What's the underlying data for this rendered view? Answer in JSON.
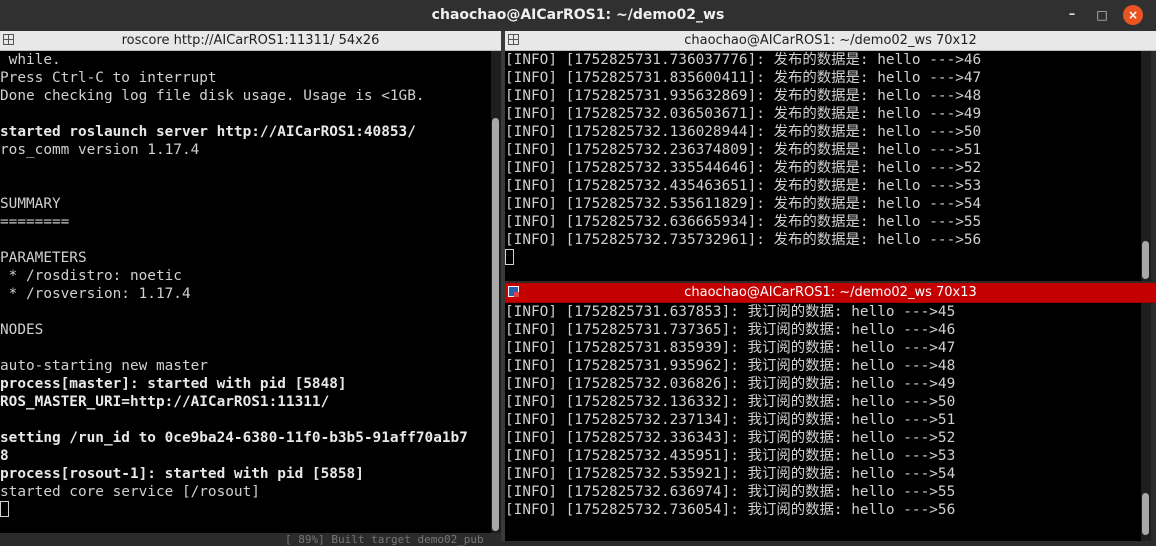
{
  "window": {
    "title": "chaochao@AICarROS1: ~/demo02_ws",
    "buttons": {
      "minimize": "–",
      "maximize": "□",
      "close": "×"
    }
  },
  "left_pane": {
    "header": "roscore http://AICarROS1:11311/ 54x26",
    "lines": [
      {
        "text": " while.",
        "bold": false
      },
      {
        "text": "Press Ctrl-C to interrupt",
        "bold": false
      },
      {
        "text": "Done checking log file disk usage. Usage is <1GB.",
        "bold": false
      },
      {
        "text": "",
        "bold": false
      },
      {
        "text": "started roslaunch server http://AICarROS1:40853/",
        "bold": true
      },
      {
        "text": "ros_comm version 1.17.4",
        "bold": false
      },
      {
        "text": "",
        "bold": false
      },
      {
        "text": "",
        "bold": false
      },
      {
        "text": "SUMMARY",
        "bold": false
      },
      {
        "text": "========",
        "bold": false
      },
      {
        "text": "",
        "bold": false
      },
      {
        "text": "PARAMETERS",
        "bold": false
      },
      {
        "text": " * /rosdistro: noetic",
        "bold": false
      },
      {
        "text": " * /rosversion: 1.17.4",
        "bold": false
      },
      {
        "text": "",
        "bold": false
      },
      {
        "text": "NODES",
        "bold": false
      },
      {
        "text": "",
        "bold": false
      },
      {
        "text": "auto-starting new master",
        "bold": false
      },
      {
        "text": "process[master]: started with pid [5848]",
        "bold": true
      },
      {
        "text": "ROS_MASTER_URI=http://AICarROS1:11311/",
        "bold": true
      },
      {
        "text": "",
        "bold": false
      },
      {
        "text": "setting /run_id to 0ce9ba24-6380-11f0-b3b5-91aff70a1b7",
        "bold": true
      },
      {
        "text": "8",
        "bold": true
      },
      {
        "text": "process[rosout-1]: started with pid [5858]",
        "bold": true
      },
      {
        "text": "started core service [/rosout]",
        "bold": false
      }
    ],
    "bottom_overflow_text": "[ 89%] Built target demo02_pub"
  },
  "top_right_pane": {
    "header": "chaochao@AICarROS1: ~/demo02_ws 70x12",
    "lines": [
      "[INFO] [1752825731.736037776]: 发布的数据是: hello --->46",
      "[INFO] [1752825731.835600411]: 发布的数据是: hello --->47",
      "[INFO] [1752825731.935632869]: 发布的数据是: hello --->48",
      "[INFO] [1752825732.036503671]: 发布的数据是: hello --->49",
      "[INFO] [1752825732.136028944]: 发布的数据是: hello --->50",
      "[INFO] [1752825732.236374809]: 发布的数据是: hello --->51",
      "[INFO] [1752825732.335544646]: 发布的数据是: hello --->52",
      "[INFO] [1752825732.435463651]: 发布的数据是: hello --->53",
      "[INFO] [1752825732.535611829]: 发布的数据是: hello --->54",
      "[INFO] [1752825732.636665934]: 发布的数据是: hello --->55",
      "[INFO] [1752825732.735732961]: 发布的数据是: hello --->56"
    ]
  },
  "bottom_right_pane": {
    "header": "chaochao@AICarROS1: ~/demo02_ws 70x13",
    "lines": [
      "[INFO] [1752825731.637853]: 我订阅的数据: hello --->45",
      "[INFO] [1752825731.737365]: 我订阅的数据: hello --->46",
      "[INFO] [1752825731.835939]: 我订阅的数据: hello --->47",
      "[INFO] [1752825731.935962]: 我订阅的数据: hello --->48",
      "[INFO] [1752825732.036826]: 我订阅的数据: hello --->49",
      "[INFO] [1752825732.136332]: 我订阅的数据: hello --->50",
      "[INFO] [1752825732.237134]: 我订阅的数据: hello --->51",
      "[INFO] [1752825732.336343]: 我订阅的数据: hello --->52",
      "[INFO] [1752825732.435951]: 我订阅的数据: hello --->53",
      "[INFO] [1752825732.535921]: 我订阅的数据: hello --->54",
      "[INFO] [1752825732.636974]: 我订阅的数据: hello --->55",
      "[INFO] [1752825732.736054]: 我订阅的数据: hello --->56"
    ]
  }
}
